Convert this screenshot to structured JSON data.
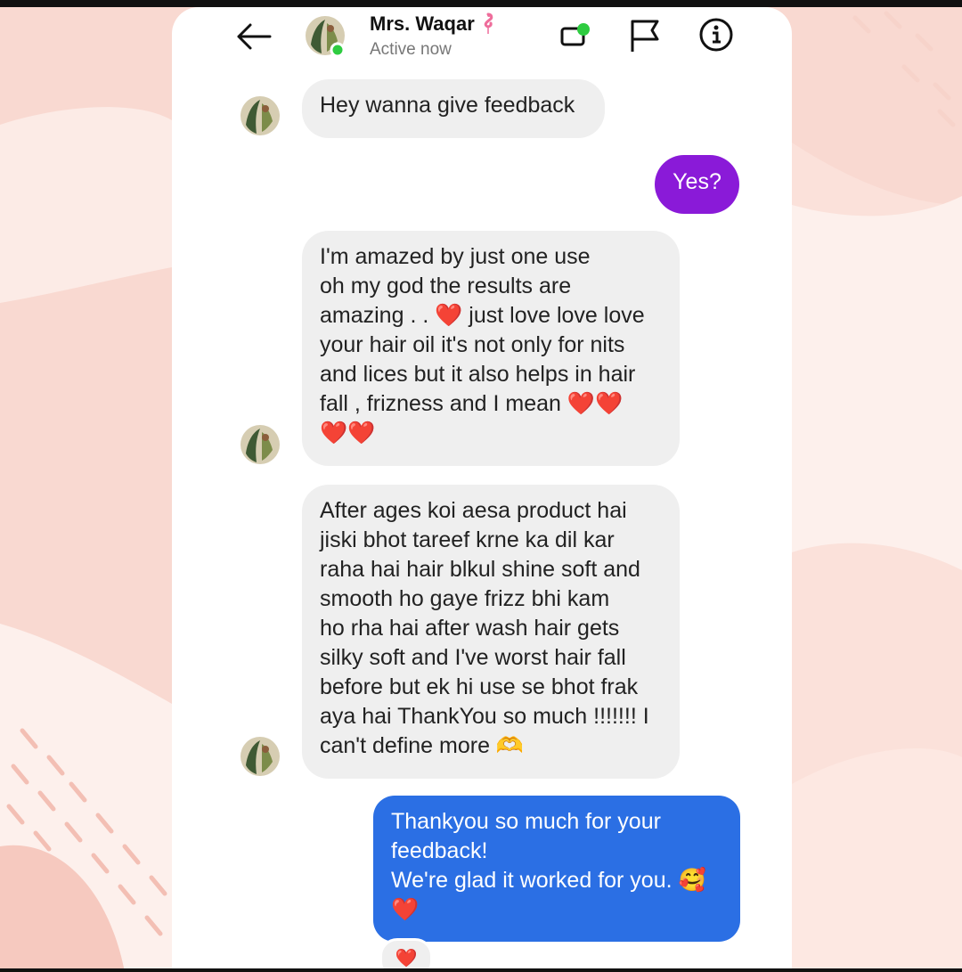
{
  "header": {
    "name": "Mrs. Waqar",
    "status": "Active now",
    "icons": [
      "back-arrow-icon",
      "video-call-icon",
      "report-flag-icon",
      "info-icon"
    ]
  },
  "messages": [
    {
      "id": "m1",
      "direction": "incoming",
      "text": "Hey wanna give feedback"
    },
    {
      "id": "m2",
      "direction": "outgoing",
      "text": "Yes?"
    },
    {
      "id": "m3",
      "direction": "incoming",
      "text": "I'm amazed by just one use\noh my god the results are\namazing . . ❤️ just love love love\nyour hair oil it's not only for nits\nand lices but it also helps in hair\nfall , frizness and I mean ❤️❤️\n❤️❤️"
    },
    {
      "id": "m4",
      "direction": "incoming",
      "text": "After ages koi aesa product hai\njiski bhot tareef krne ka dil kar\nraha hai hair blkul shine soft and\nsmooth ho gaye frizz bhi kam\nho rha hai after wash hair gets\nsilky soft and I've worst hair fall\nbefore but ek hi use se bhot frak\naya hai ThankYou so much !!!!!!! I\ncan't define more 🫶"
    },
    {
      "id": "m5",
      "direction": "outgoing",
      "text": "Thankyou so much for your\nfeedback!\nWe're glad it worked for you. 🥰\n❤️"
    }
  ],
  "reaction": "❤️",
  "colors": {
    "background": "#f9d9d1",
    "incoming_bubble": "#efefef",
    "outgoing_purple": "#8a1ad8",
    "outgoing_blue": "#2b6fe4",
    "active_dot": "#2ecc40"
  }
}
